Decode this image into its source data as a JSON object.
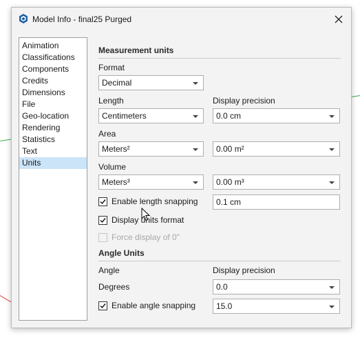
{
  "dialog": {
    "title": "Model Info - final25 Purged"
  },
  "nav": {
    "items": [
      {
        "label": "Animation"
      },
      {
        "label": "Classifications"
      },
      {
        "label": "Components"
      },
      {
        "label": "Credits"
      },
      {
        "label": "Dimensions"
      },
      {
        "label": "File"
      },
      {
        "label": "Geo-location"
      },
      {
        "label": "Rendering"
      },
      {
        "label": "Statistics"
      },
      {
        "label": "Text"
      },
      {
        "label": "Units"
      }
    ],
    "selected": "Units"
  },
  "measurement": {
    "section_title": "Measurement units",
    "format_label": "Format",
    "format_value": "Decimal",
    "length_label": "Length",
    "length_value": "Centimeters",
    "display_precision_label": "Display precision",
    "length_precision_value": "0.0 cm",
    "area_label": "Area",
    "area_value": "Meters²",
    "area_precision_value": "0.00 m²",
    "volume_label": "Volume",
    "volume_value": "Meters³",
    "volume_precision_value": "0.00 m³",
    "enable_length_snapping_label": "Enable length snapping",
    "enable_length_snapping_checked": true,
    "length_snapping_value": "0.1 cm",
    "display_units_format_label": "Display units format",
    "display_units_format_checked": true,
    "force_display_label": "Force display of 0\"",
    "force_display_checked": false
  },
  "angle": {
    "section_title": "Angle Units",
    "angle_label": "Angle",
    "display_precision_label": "Display precision",
    "angle_value": "Degrees",
    "precision_value": "0.0",
    "enable_angle_snapping_label": "Enable angle snapping",
    "enable_angle_snapping_checked": true,
    "snapping_value": "15.0"
  },
  "colors": {
    "selection": "#cce4f7",
    "dialog_bg": "#f3f3f3",
    "axis_green": "#3aa84a",
    "axis_red": "#d23c3c"
  }
}
